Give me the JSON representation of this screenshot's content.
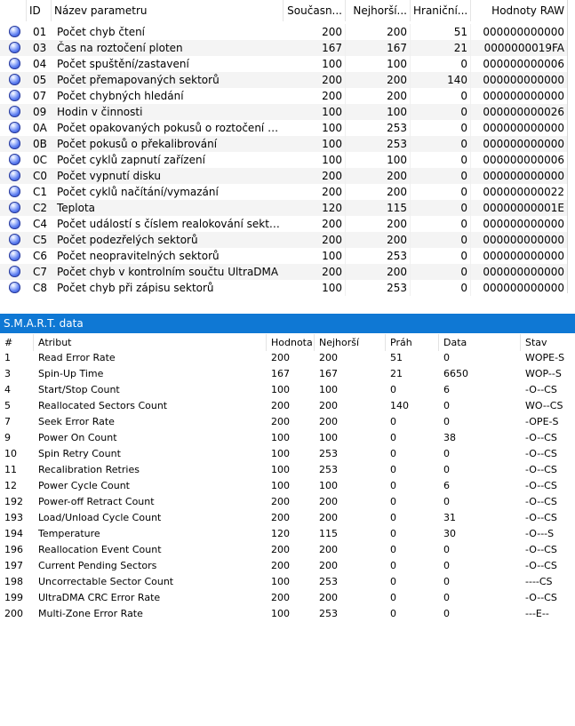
{
  "attributes_table": {
    "headers": {
      "id": "ID",
      "name": "Název parametru",
      "current": "Současn...",
      "worst": "Nejhorší...",
      "threshold": "Hraniční...",
      "raw": "Hodnoty RAW"
    },
    "rows": [
      {
        "id": "01",
        "name": "Počet chyb čtení",
        "current": "200",
        "worst": "200",
        "threshold": "51",
        "raw": "000000000000"
      },
      {
        "id": "03",
        "name": "Čas na roztočení ploten",
        "current": "167",
        "worst": "167",
        "threshold": "21",
        "raw": "0000000019FA"
      },
      {
        "id": "04",
        "name": "Počet spuštění/zastavení",
        "current": "100",
        "worst": "100",
        "threshold": "0",
        "raw": "000000000006"
      },
      {
        "id": "05",
        "name": "Počet přemapovaných sektorů",
        "current": "200",
        "worst": "200",
        "threshold": "140",
        "raw": "000000000000"
      },
      {
        "id": "07",
        "name": "Počet chybných hledání",
        "current": "200",
        "worst": "200",
        "threshold": "0",
        "raw": "000000000000"
      },
      {
        "id": "09",
        "name": "Hodin v činnosti",
        "current": "100",
        "worst": "100",
        "threshold": "0",
        "raw": "000000000026"
      },
      {
        "id": "0A",
        "name": "Počet opakovaných pokusů o roztočení p...",
        "current": "100",
        "worst": "253",
        "threshold": "0",
        "raw": "000000000000"
      },
      {
        "id": "0B",
        "name": "Počet pokusů o překalibrování",
        "current": "100",
        "worst": "253",
        "threshold": "0",
        "raw": "000000000000"
      },
      {
        "id": "0C",
        "name": "Počet cyklů zapnutí zařízení",
        "current": "100",
        "worst": "100",
        "threshold": "0",
        "raw": "000000000006"
      },
      {
        "id": "C0",
        "name": "Počet vypnutí disku",
        "current": "200",
        "worst": "200",
        "threshold": "0",
        "raw": "000000000000"
      },
      {
        "id": "C1",
        "name": "Počet cyklů načítání/vymazání",
        "current": "200",
        "worst": "200",
        "threshold": "0",
        "raw": "000000000022"
      },
      {
        "id": "C2",
        "name": "Teplota",
        "current": "120",
        "worst": "115",
        "threshold": "0",
        "raw": "00000000001E"
      },
      {
        "id": "C4",
        "name": "Počet událostí s číslem realokování sektorů",
        "current": "200",
        "worst": "200",
        "threshold": "0",
        "raw": "000000000000"
      },
      {
        "id": "C5",
        "name": "Počet podezřelých sektorů",
        "current": "200",
        "worst": "200",
        "threshold": "0",
        "raw": "000000000000"
      },
      {
        "id": "C6",
        "name": "Počet neopravitelných sektorů",
        "current": "100",
        "worst": "253",
        "threshold": "0",
        "raw": "000000000000"
      },
      {
        "id": "C7",
        "name": "Počet chyb v kontrolním součtu UltraDMA",
        "current": "200",
        "worst": "200",
        "threshold": "0",
        "raw": "000000000000"
      },
      {
        "id": "C8",
        "name": "Počet chyb při zápisu sektorů",
        "current": "100",
        "worst": "253",
        "threshold": "0",
        "raw": "000000000000"
      }
    ]
  },
  "smart_section": {
    "title": "S.M.A.R.T. data",
    "accent_color": "#0f78d4",
    "headers": {
      "num": "#",
      "attr": "Atribut",
      "value": "Hodnota",
      "worst": "Nejhorší",
      "threshold": "Práh",
      "data": "Data",
      "status": "Stav"
    },
    "rows": [
      {
        "num": "1",
        "attr": "Read Error Rate",
        "value": "200",
        "worst": "200",
        "threshold": "51",
        "data": "0",
        "status": "WOPE-S"
      },
      {
        "num": "3",
        "attr": "Spin-Up Time",
        "value": "167",
        "worst": "167",
        "threshold": "21",
        "data": "6650",
        "status": "WOP--S"
      },
      {
        "num": "4",
        "attr": "Start/Stop Count",
        "value": "100",
        "worst": "100",
        "threshold": "0",
        "data": "6",
        "status": "-O--CS"
      },
      {
        "num": "5",
        "attr": "Reallocated Sectors Count",
        "value": "200",
        "worst": "200",
        "threshold": "140",
        "data": "0",
        "status": "WO--CS"
      },
      {
        "num": "7",
        "attr": "Seek Error Rate",
        "value": "200",
        "worst": "200",
        "threshold": "0",
        "data": "0",
        "status": "-OPE-S"
      },
      {
        "num": "9",
        "attr": "Power On Count",
        "value": "100",
        "worst": "100",
        "threshold": "0",
        "data": "38",
        "status": "-O--CS"
      },
      {
        "num": "10",
        "attr": "Spin Retry Count",
        "value": "100",
        "worst": "253",
        "threshold": "0",
        "data": "0",
        "status": "-O--CS"
      },
      {
        "num": "11",
        "attr": "Recalibration Retries",
        "value": "100",
        "worst": "253",
        "threshold": "0",
        "data": "0",
        "status": "-O--CS"
      },
      {
        "num": "12",
        "attr": "Power Cycle Count",
        "value": "100",
        "worst": "100",
        "threshold": "0",
        "data": "6",
        "status": "-O--CS"
      },
      {
        "num": "192",
        "attr": "Power-off Retract Count",
        "value": "200",
        "worst": "200",
        "threshold": "0",
        "data": "0",
        "status": "-O--CS"
      },
      {
        "num": "193",
        "attr": "Load/Unload Cycle Count",
        "value": "200",
        "worst": "200",
        "threshold": "0",
        "data": "31",
        "status": "-O--CS"
      },
      {
        "num": "194",
        "attr": "Temperature",
        "value": "120",
        "worst": "115",
        "threshold": "0",
        "data": "30",
        "status": "-O---S"
      },
      {
        "num": "196",
        "attr": "Reallocation Event Count",
        "value": "200",
        "worst": "200",
        "threshold": "0",
        "data": "0",
        "status": "-O--CS"
      },
      {
        "num": "197",
        "attr": "Current Pending Sectors",
        "value": "200",
        "worst": "200",
        "threshold": "0",
        "data": "0",
        "status": "-O--CS"
      },
      {
        "num": "198",
        "attr": "Uncorrectable Sector Count",
        "value": "100",
        "worst": "253",
        "threshold": "0",
        "data": "0",
        "status": "----CS"
      },
      {
        "num": "199",
        "attr": "UltraDMA CRC Error Rate",
        "value": "200",
        "worst": "200",
        "threshold": "0",
        "data": "0",
        "status": "-O--CS"
      },
      {
        "num": "200",
        "attr": "Multi-Zone Error Rate",
        "value": "100",
        "worst": "253",
        "threshold": "0",
        "data": "0",
        "status": "---E--"
      }
    ]
  }
}
